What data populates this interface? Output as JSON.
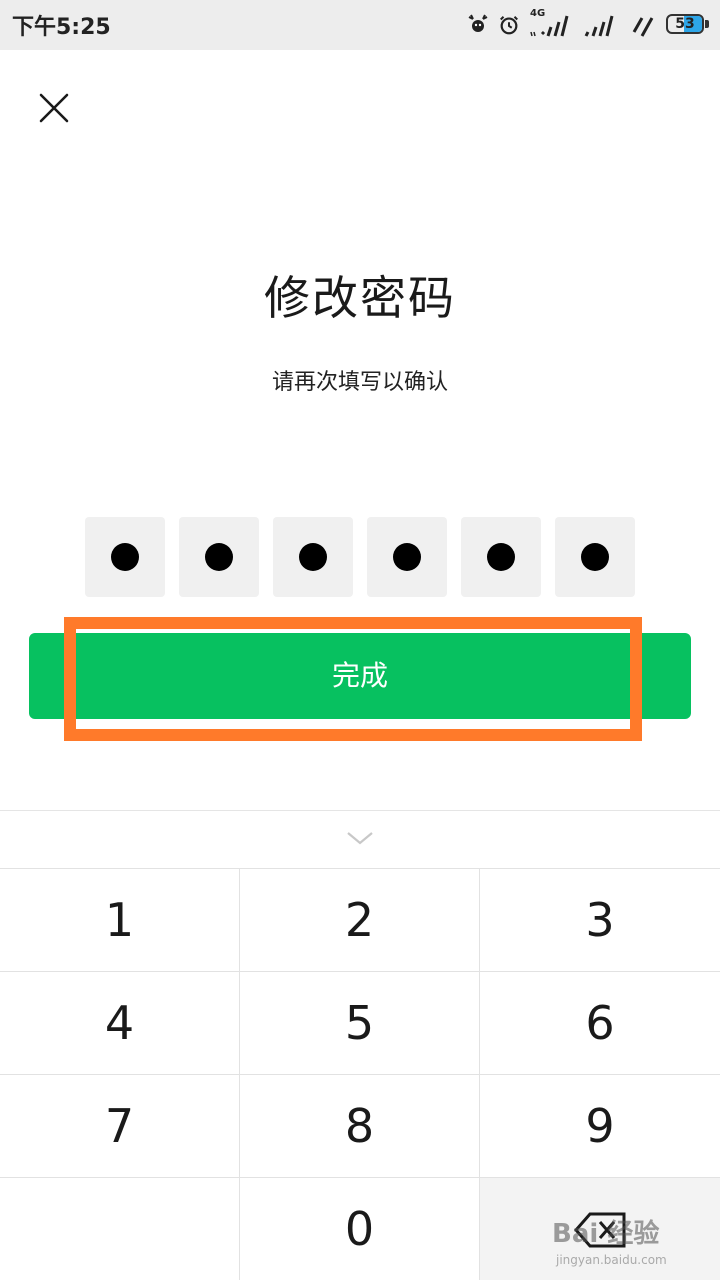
{
  "status_bar": {
    "time": "下午5:25",
    "network_label": "4G",
    "battery_level": "53",
    "battery_color": "#2da6e8"
  },
  "header": {
    "close_icon": "close-icon"
  },
  "title": "修改密码",
  "subtitle": "请再次填写以确认",
  "pin": {
    "length": 6,
    "filled": 6
  },
  "done_button": {
    "label": "完成",
    "color": "#07c160"
  },
  "highlight_color": "#ff7a2a",
  "keypad": {
    "keys": [
      "1",
      "2",
      "3",
      "4",
      "5",
      "6",
      "7",
      "8",
      "9",
      "",
      "0",
      "delete"
    ],
    "collapse_icon": "chevron-down-icon",
    "delete_icon": "backspace-icon"
  },
  "watermark": {
    "brand": "Bai 经验",
    "url": "jingyan.baidu.com"
  }
}
